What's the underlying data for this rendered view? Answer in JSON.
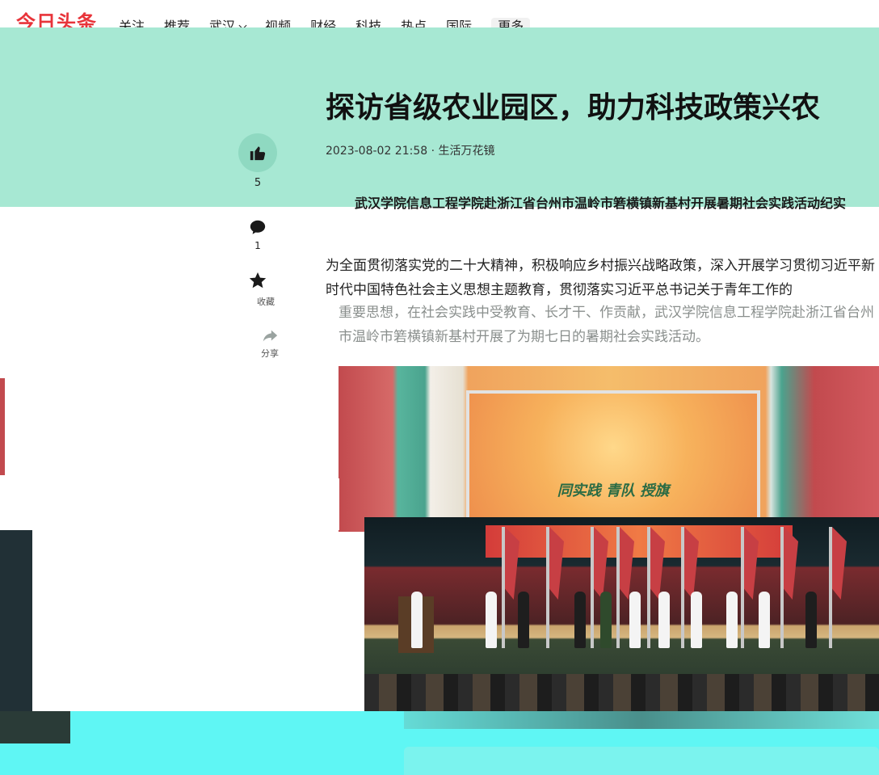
{
  "logo": {
    "text": "今日头条",
    "color": "#e8343a"
  },
  "nav": {
    "items": [
      "关注",
      "推荐",
      "武汉",
      "视频",
      "财经",
      "科技",
      "热点",
      "国际"
    ],
    "more": "更多",
    "dropdown_item": "武汉"
  },
  "article": {
    "title": "探访省级农业园区，助力科技政策兴农",
    "meta": "2023-08-02 21:58 · 生活万花镜",
    "subtitle": "武汉学院信息工程学院赴浙江省台州市温岭市箬横镇新基村开展暑期社会实践活动纪实",
    "paragraph_1": "为全面贯彻落实党的二十大精神，积极响应乡村振兴战略政策，深入开展学习贯彻习近平新时代中国特色社会主义思想主题教育，贯彻落实习近平总书记关于青年工作的",
    "paragraph_2": "重要思想，在社会实践中受教育、长才干、作贡献，武汉学院信息工程学院赴浙江省台州市温岭市箬横镇新基村开展了为期七日的暑期社会实践活动。",
    "photo_caption": "同实践 青队 授旗"
  },
  "rail": {
    "like_count": "5",
    "comment_count": "1",
    "favorite_label": "收藏",
    "share_label": "分享"
  },
  "colors": {
    "hero_bg": "#a7e8d3",
    "accent": "#e8343a"
  }
}
